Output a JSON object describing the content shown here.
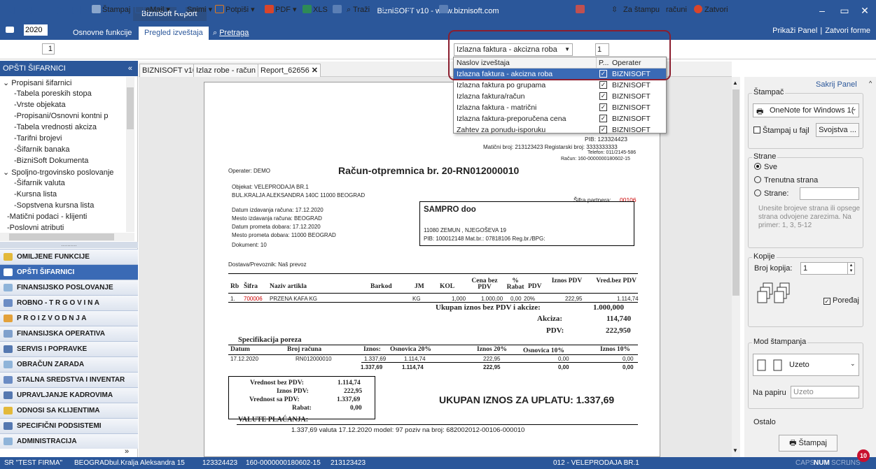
{
  "app": {
    "title": "BizniSOFT v10 - www.biznisoft.com",
    "context_tab": "BizniSoft Report",
    "year": "2020",
    "tabs": [
      "Osnovne funkcije",
      "Pregled izveštaja",
      "Pretraga"
    ],
    "right_links": [
      "Prikaži Panel",
      "Zatvori forme"
    ],
    "window_buttons": [
      "–",
      "▭",
      "✕"
    ]
  },
  "toolbar": {
    "page": "1",
    "stampaj": "Štampaj",
    "email": "eMail",
    "snimi": "Snimi",
    "potpisi": "Potpiši",
    "pdf": "PDF",
    "xls": "XLS",
    "trazi": "Traži",
    "report_select": "Izlazna faktura - akcizna roba",
    "copies": "1",
    "za_stampu": "Za štampu",
    "racuni": "računi",
    "zatvori": "Zatvori"
  },
  "dropdown": {
    "col1": "Naslov izveštaja",
    "col2": "P...",
    "col3": "Operater",
    "rows": [
      {
        "name": "Izlazna faktura - akcizna roba",
        "op": "BIZNISOFT",
        "selected": true
      },
      {
        "name": "Izlazna faktura po grupama",
        "op": "BIZNISOFT"
      },
      {
        "name": "Izlazna faktura/račun",
        "op": "BIZNISOFT"
      },
      {
        "name": "Izlazna faktura - matrični",
        "op": "BIZNISOFT"
      },
      {
        "name": "Izlazna faktura-preporučena cena",
        "op": "BIZNISOFT"
      },
      {
        "name": "Zahtev za ponudu-isporuku",
        "op": "BIZNISOFT"
      }
    ]
  },
  "left": {
    "header": "OPŠTI ŠIFARNICI",
    "collapse": "«",
    "tree": [
      "Propisani šifarnici",
      "Tabela poreskih stopa",
      "Vrste objekata",
      "Propisani/Osnovni kontni p",
      "Tabela vrednosti akciza",
      "Tarifni brojevi",
      "Šifarnik banaka",
      "BizniSoft Dokumenta",
      "Spoljno-trgovinsko poslovanje",
      "Šifarnik valuta",
      "Kursna lista",
      "Sopstvena kursna lista",
      "Matični podaci - klijenti",
      "Poslovni atributi"
    ],
    "dots": "..........",
    "modules": [
      "OMILJENE FUNKCIJE",
      "OPŠTI ŠIFARNICI",
      "FINANSIJSKO POSLOVANJE",
      "ROBNO - T R G O V I N A",
      "P R O I Z V O D N J A",
      "FINANSIJSKA OPERATIVA",
      "SERVIS I POPRAVKE",
      "OBRAČUN ZARADA",
      "STALNA SREDSTVA I INVENTAR",
      "UPRAVLJANJE KADROVIMA",
      "ODNOSI SA KLIJENTIMA",
      "SPECIFIČNI PODSISTEMI",
      "ADMINISTRACIJA"
    ],
    "more": "»"
  },
  "doc_tabs": [
    "BIZNISOFT v10",
    "Izlaz robe - račun",
    "Report_62656"
  ],
  "report": {
    "pib": "PIB: 123324423",
    "ids": "Matični broj: 213123423  Registarski broj: 3333333333",
    "telefon": "Telefon: 011/2145-586",
    "racun": "Račun: 160-0000000180602-15",
    "operater": "Operater: DEMO",
    "title": "Račun-otpremnica br. 20-RN012000010",
    "objekat": "Objekat: VELEPRODAJA BR.1",
    "adresa": "BUL.KRALJA ALEKSANDRA 140C 11000 BEOGRAD",
    "sifra_partnera_label": "Šifra partnera:",
    "sifra_partnera": "00106",
    "datum_izd": "Datum izdavanja računa: 17.12.2020",
    "mesto_izd": "Mesto izdavanja računa: BEOGRAD",
    "datum_prom": "Datum prometa dobara: 17.12.2020",
    "mesto_prom": "Mesto prometa dobara: 11000 BEOGRAD",
    "dokument": "Dokument: 10",
    "kupac": "SAMPRO doo",
    "kupac_adresa": "11080 ZEMUN , NJEGOŠEVA 19",
    "kupac_ids": "PIB: 100012148  Mat.br.: 07818106  Reg.br./BPG:",
    "dostava": "Dostava/Prevoznik: Naš prevoz",
    "cols": [
      "Rb",
      "Šifra",
      "Naziv artikla",
      "Barkod",
      "JM",
      "KOL",
      "Cena bez PDV",
      "% Rabat",
      "PDV",
      "Iznos PDV",
      "Vred.bez PDV"
    ],
    "item": {
      "rb": "1.",
      "sifra": "700006",
      "naziv": "PRZENA KAFA KG",
      "jm": "KG",
      "kol": "1,000",
      "cena": "1.000,00",
      "rabat": "0,00",
      "pdv": "20%",
      "iznos": "222,95",
      "vred": "1.114,74"
    },
    "ukupan_label": "Ukupan iznos bez PDV i akcize:",
    "ukupan": "1.000,000",
    "akciza_label": "Akciza:",
    "akciza": "114,740",
    "pdv_label": "PDV:",
    "pdv": "222,950",
    "spec_title": "Specifikacija poreza",
    "spec_cols": [
      "Datum",
      "Broj računa",
      "Iznos:",
      "Osnovica 20%",
      "Iznos 20%",
      "Osnovica 10%",
      "Iznos 10%"
    ],
    "spec_row": [
      "17.12.2020",
      "RN012000010",
      "1.337,69",
      "1.114,74",
      "222,95",
      "0,00",
      "0,00"
    ],
    "spec_total": [
      "1.337,69",
      "1.114,74",
      "222,95",
      "0,00",
      "0,00"
    ],
    "sum_labels": [
      "Vrednost bez PDV:",
      "Iznos PDV:",
      "Vrednost sa PDV:",
      "Rabat:"
    ],
    "sum_values": [
      "1.114,74",
      "222,95",
      "1.337,69",
      "0,00"
    ],
    "za_uplatu": "UKUPAN IZNOS ZA UPLATU: 1.337,69",
    "valute_title": "VALUTE PLAĆANJA:",
    "valute_line": "1.337,69  valuta 17.12.2020 model: 97 poziv na broj: 682002012-00106-000010"
  },
  "right": {
    "hide": "Sakrij Panel",
    "stampac": "Štampač",
    "printer": "OneNote for Windows 1(",
    "stampaj_fajl": "Štampaj u fajl",
    "svojstva": "Svojstva ...",
    "strane": "Strane",
    "sve": "Sve",
    "trenutna": "Trenutna strana",
    "strane_opt": "Strane:",
    "hint": "Unesite brojeve strana ili opsege strana odvojene zarezima. Na primer: 1, 3, 5-12",
    "kopije": "Kopije",
    "broj_kopija": "Broj kopija:",
    "broj_kopija_val": "1",
    "poredaj": "Poređaj",
    "mod": "Mod štampanja",
    "uzeto": "Uzeto",
    "na_papiru": "Na papiru",
    "na_papiru_val": "Uzeto",
    "ostalo": "Ostalo",
    "stampaj_btn": "Štampaj"
  },
  "status": {
    "firma": "SR \"TEST FIRMA\"",
    "grad": "BEOGRAD",
    "adresa": "bul.Kralja Aleksandra 15",
    "pib": "123324423",
    "racun": "160-0000000180602-15",
    "mb": "213123423",
    "objekat": "012 - VELEPRODAJA BR.1",
    "caps": "CAPS",
    "num": "NUM",
    "scrl": "SCRL",
    "ins": "INS",
    "notif": "10"
  }
}
